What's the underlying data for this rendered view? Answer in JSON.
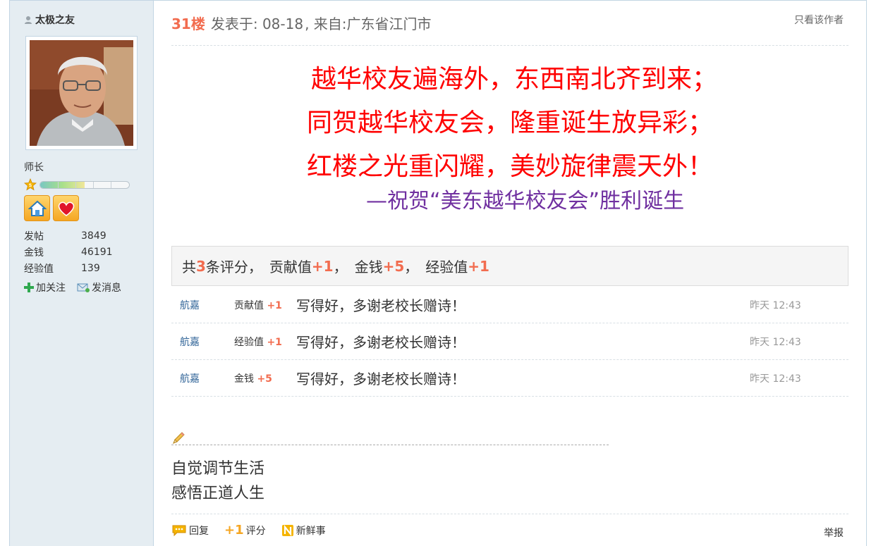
{
  "author": {
    "name": "太极之友",
    "rank": "师长",
    "level": "5",
    "level_progress": 0.5,
    "stats": [
      {
        "label": "发帖",
        "value": "3849"
      },
      {
        "label": "金钱",
        "value": "46191"
      },
      {
        "label": "经验值",
        "value": "139"
      }
    ],
    "actions": {
      "follow": "加关注",
      "message": "发消息"
    }
  },
  "post": {
    "floor": "31楼",
    "posted_at": "发表于: 08-18",
    "location": ", 来自:广东省江门市",
    "only_author": "只看该作者",
    "poem": [
      "越华校友遍海外，东西南北齐到来；",
      "同贺越华校友会，隆重诞生放异彩；",
      "红楼之光重闪耀，美妙旋律震天外！"
    ],
    "poem_subtitle": "—祝贺“美东越华校友会”胜利诞生",
    "colors": {
      "poem": "#ff0000",
      "subtitle": "#7030a0",
      "accent": "#f26c4f"
    }
  },
  "rating": {
    "summary": {
      "prefix": "共",
      "count": "3",
      "count_suffix": "条评分，",
      "items": [
        {
          "label": "贡献值",
          "value": "+1",
          "sep": "，"
        },
        {
          "label": "金钱",
          "value": "+5",
          "sep": "，"
        },
        {
          "label": "经验值",
          "value": "+1",
          "sep": ""
        }
      ]
    },
    "rows": [
      {
        "user": "航嘉",
        "type": "贡献值",
        "value": "+1",
        "reason": "写得好，多谢老校长赠诗！",
        "time": "昨天 12:43"
      },
      {
        "user": "航嘉",
        "type": "经验值",
        "value": "+1",
        "reason": "写得好，多谢老校长赠诗！",
        "time": "昨天 12:43"
      },
      {
        "user": "航嘉",
        "type": "金钱",
        "value": "+5",
        "reason": "写得好，多谢老校长赠诗！",
        "time": "昨天 12:43"
      }
    ]
  },
  "signature": [
    "自觉调节生活",
    "感悟正道人生"
  ],
  "footer": {
    "reply": "回复",
    "rate_plus": "+1",
    "rate": "评分",
    "news": "新鲜事",
    "report": "举报"
  }
}
